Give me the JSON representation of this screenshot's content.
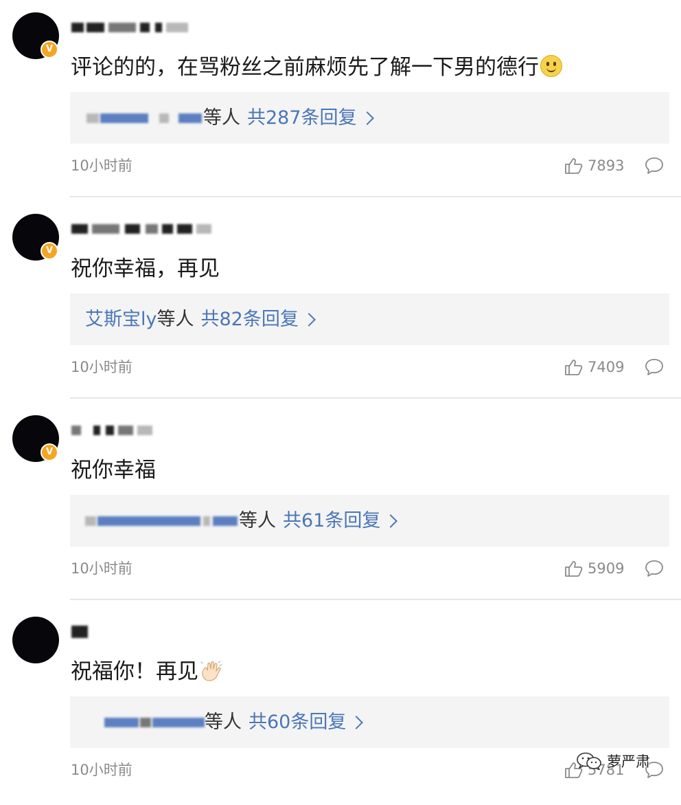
{
  "comments": [
    {
      "username": "",
      "verified": true,
      "text": "评论的的，在骂粉丝之前麻烦先了解一下男的德行",
      "emoji": "smile-icon",
      "reply_named": "",
      "reply_suffix": "等人",
      "reply_count": "共287条回复",
      "time": "10小时前",
      "likes": "7893"
    },
    {
      "username": "",
      "verified": true,
      "text": "祝你幸福，再见",
      "emoji": "",
      "reply_named": "艾斯宝ly",
      "reply_suffix": "等人",
      "reply_count": "共82条回复",
      "time": "10小时前",
      "likes": "7409"
    },
    {
      "username": "",
      "verified": true,
      "text": "祝你幸福",
      "emoji": "",
      "reply_named": "",
      "reply_suffix": "等人",
      "reply_count": "共61条回复",
      "time": "10小时前",
      "likes": "5909"
    },
    {
      "username": "",
      "verified": false,
      "text": "祝福你！再见",
      "emoji": "waving-hand-icon",
      "reply_named": "",
      "reply_suffix": "等人",
      "reply_count": "共60条回复",
      "time": "10小时前",
      "likes": "5781"
    }
  ],
  "watermark": {
    "icon": "wechat-icon",
    "text": "萝严肃"
  },
  "colors": {
    "link_blue": "#4a76b8",
    "verified_badge": "#f4a623",
    "reply_box_bg": "#f4f4f4",
    "meta_gray": "#8a8a8a"
  }
}
